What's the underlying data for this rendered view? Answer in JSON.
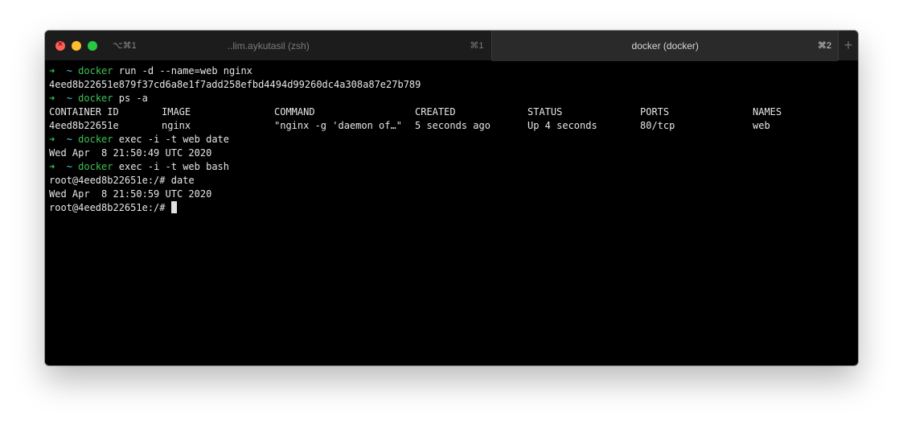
{
  "window": {
    "tabs": [
      {
        "shortcut_left": "⌥⌘1",
        "title": "..lim.aykutasil (zsh)",
        "shortcut": "⌘1"
      },
      {
        "title": "docker (docker)",
        "shortcut": "⌘2"
      }
    ],
    "new_tab_label": "+"
  },
  "terminal": {
    "prompt_arrow": "➜",
    "prompt_dir": "~",
    "lines": {
      "l1": {
        "cmd": "docker",
        "args": " run -d --name=web nginx"
      },
      "l2": "4eed8b22651e879f37cd6a8e1f7add258efbd4494d99260dc4a308a87e27b789",
      "l3": {
        "cmd": "docker",
        "args": " ps -a"
      },
      "header": [
        "CONTAINER ID",
        "IMAGE",
        "COMMAND",
        "CREATED",
        "STATUS",
        "PORTS",
        "NAMES"
      ],
      "row": [
        "4eed8b22651e",
        "nginx",
        "\"nginx -g 'daemon of…\"",
        "5 seconds ago",
        "Up 4 seconds",
        "80/tcp",
        "web"
      ],
      "l6": {
        "cmd": "docker",
        "args": " exec -i -t web date"
      },
      "l7": "Wed Apr  8 21:50:49 UTC 2020",
      "l8": {
        "cmd": "docker",
        "args": " exec -i -t web bash"
      },
      "l9": "root@4eed8b22651e:/# date",
      "l10": "Wed Apr  8 21:50:59 UTC 2020",
      "l11": "root@4eed8b22651e:/# "
    }
  }
}
